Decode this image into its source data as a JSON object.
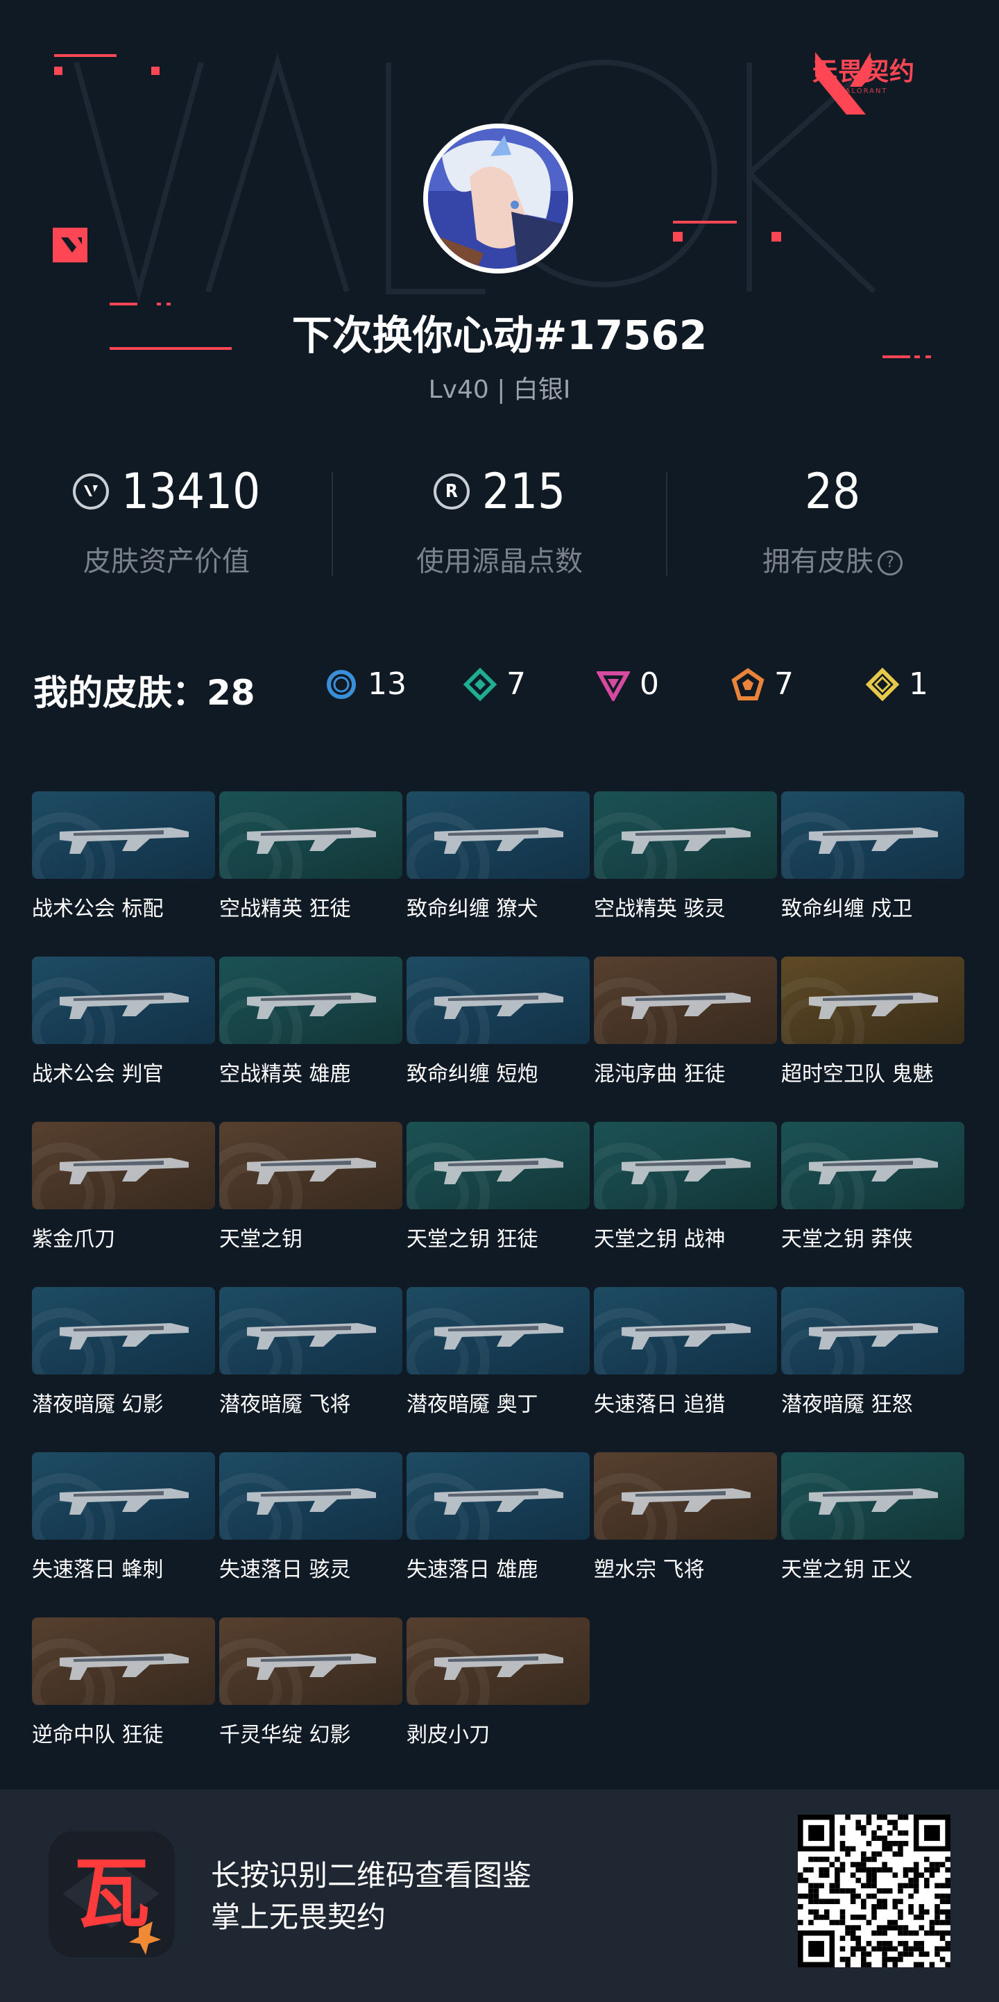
{
  "profile": {
    "name": "下次换你心动#17562",
    "level": "Lv40 | 白银I"
  },
  "brand": {
    "title": "无畏契约",
    "subtitle": "VALORANT",
    "accent": "#ff4655"
  },
  "stats": [
    {
      "value": "13410",
      "label": "皮肤资产价值",
      "icon": "valorant-coin-icon"
    },
    {
      "value": "215",
      "label": "使用源晶点数",
      "icon": "radianite-icon"
    },
    {
      "value": "28",
      "label": "拥有皮肤",
      "icon": "help-icon"
    }
  ],
  "summary": {
    "title": "我的皮肤：",
    "count": "28",
    "tiers": [
      {
        "icon": "select-tier-icon",
        "count": "13",
        "color": "#3a8fd9"
      },
      {
        "icon": "deluxe-tier-icon",
        "count": "7",
        "color": "#1fae94"
      },
      {
        "icon": "premium-tier-icon",
        "count": "0",
        "color": "#d64ba0"
      },
      {
        "icon": "exclusive-tier-icon",
        "count": "7",
        "color": "#e9843a"
      },
      {
        "icon": "ultra-tier-icon",
        "count": "1",
        "color": "#e6c84a"
      }
    ]
  },
  "skins": [
    {
      "label": "战术公会 标配",
      "bg": "blue"
    },
    {
      "label": "空战精英 狂徒",
      "bg": "green"
    },
    {
      "label": "致命纠缠 獠犬",
      "bg": "blue"
    },
    {
      "label": "空战精英 骇灵",
      "bg": "green"
    },
    {
      "label": "致命纠缠 戍卫",
      "bg": "blue"
    },
    {
      "label": "战术公会 判官",
      "bg": "blue"
    },
    {
      "label": "空战精英 雄鹿",
      "bg": "green"
    },
    {
      "label": "致命纠缠 短炮",
      "bg": "blue"
    },
    {
      "label": "混沌序曲 狂徒",
      "bg": "brown"
    },
    {
      "label": "超时空卫队 鬼魅",
      "bg": "gold"
    },
    {
      "label": "紫金爪刀",
      "bg": "brown"
    },
    {
      "label": "天堂之钥",
      "bg": "brown"
    },
    {
      "label": "天堂之钥 狂徒",
      "bg": "green"
    },
    {
      "label": "天堂之钥 战神",
      "bg": "green"
    },
    {
      "label": "天堂之钥 莽侠",
      "bg": "green"
    },
    {
      "label": "潜夜暗魇 幻影",
      "bg": "blue"
    },
    {
      "label": "潜夜暗魇 飞将",
      "bg": "blue"
    },
    {
      "label": "潜夜暗魇 奥丁",
      "bg": "blue"
    },
    {
      "label": "失速落日 追猎",
      "bg": "blue"
    },
    {
      "label": "潜夜暗魇 狂怒",
      "bg": "blue"
    },
    {
      "label": "失速落日 蜂刺",
      "bg": "blue"
    },
    {
      "label": "失速落日 骇灵",
      "bg": "blue"
    },
    {
      "label": "失速落日 雄鹿",
      "bg": "blue"
    },
    {
      "label": "塑水宗 飞将",
      "bg": "brown"
    },
    {
      "label": "天堂之钥 正义",
      "bg": "green"
    },
    {
      "label": "逆命中队 狂徒",
      "bg": "brown"
    },
    {
      "label": "千灵华绽 幻影",
      "bg": "brown"
    },
    {
      "label": "剥皮小刀",
      "bg": "brown"
    }
  ],
  "footer": {
    "line1": "长按识别二维码查看图鉴",
    "line2": "掌上无畏契约",
    "app_glyph": "瓦"
  }
}
